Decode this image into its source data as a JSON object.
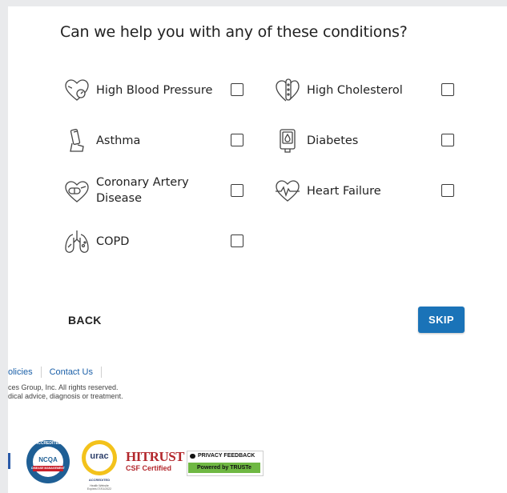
{
  "heading": "Can we help you with any of these conditions?",
  "conditions": [
    {
      "id": "high-blood-pressure",
      "label": "High Blood Pressure",
      "icon": "heart-gauge-icon",
      "checked": false
    },
    {
      "id": "high-cholesterol",
      "label": "High Cholesterol",
      "icon": "heart-artery-icon",
      "checked": false
    },
    {
      "id": "asthma",
      "label": "Asthma",
      "icon": "inhaler-icon",
      "checked": false
    },
    {
      "id": "diabetes",
      "label": "Diabetes",
      "icon": "insulin-pump-icon",
      "checked": false
    },
    {
      "id": "coronary-artery-disease",
      "label_line1": "Coronary Artery",
      "label_line2": "Disease",
      "icon": "heart-pill-icon",
      "checked": false
    },
    {
      "id": "heart-failure",
      "label": "Heart Failure",
      "icon": "heart-pulse-icon",
      "checked": false
    },
    {
      "id": "copd",
      "label": "COPD",
      "icon": "lungs-icon",
      "checked": false
    }
  ],
  "buttons": {
    "back": "BACK",
    "skip": "SKIP"
  },
  "colors": {
    "primary": "#1a73b8",
    "link": "#1a5fa8",
    "text": "#222222"
  },
  "footer": {
    "links": [
      "olicies",
      "Contact Us"
    ],
    "line1": "ces Group, Inc.  All rights reserved.",
    "line2": "dical advice, diagnosis or treatment."
  },
  "badges": {
    "ncqa": {
      "ring": "ACCREDITED",
      "name": "NCQA",
      "sub": "DISEASE MANAGEMENT"
    },
    "urac": {
      "name": "urac",
      "sub": "ACCREDITED",
      "note1": "Health Website",
      "note2": "Expires 07/01/2022"
    },
    "hitrust": {
      "name": "HITRUST",
      "sub": "CSF Certified"
    },
    "truste": {
      "top": "PRIVACY FEEDBACK",
      "bottom": "Powered by TRUSTe"
    }
  }
}
